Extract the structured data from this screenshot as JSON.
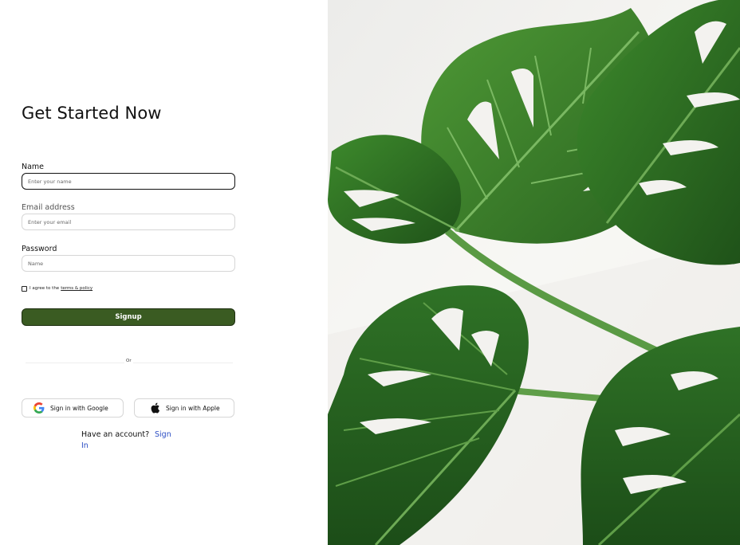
{
  "form": {
    "title": "Get Started Now",
    "name_label": "Name",
    "name_placeholder": "Enter your name",
    "email_label": "Email address",
    "email_placeholder": "Enter your email",
    "password_label": "Password",
    "password_placeholder": "Name",
    "agree_text": "I agree to the",
    "terms_link": "terms & policy",
    "submit_label": "Signup",
    "divider_text": "Or",
    "google_label": "Sign in with Google",
    "apple_label": "Sign in with Apple",
    "have_account_text": "Have an account?",
    "signin_link_part1": "Sign",
    "signin_link_part2": "In"
  },
  "hero": {
    "image": "monstera-leaves-photo"
  },
  "colors": {
    "primary": "#3a5b22",
    "link": "#2d4fc4",
    "leaf_dark": "#2e6b25",
    "leaf_light": "#4a8d33"
  },
  "icons": {
    "google": "google-icon",
    "apple": "apple-icon"
  }
}
